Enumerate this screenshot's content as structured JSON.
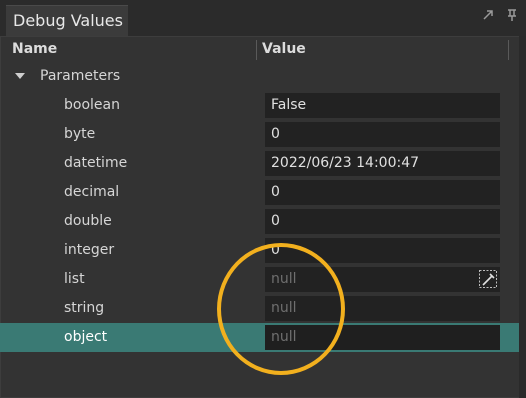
{
  "window": {
    "title": "Debug Values"
  },
  "columns": {
    "name": "Name",
    "value": "Value"
  },
  "group": {
    "label": "Parameters"
  },
  "rows": [
    {
      "name": "boolean",
      "value": "False",
      "is_null": false
    },
    {
      "name": "byte",
      "value": "0",
      "is_null": false
    },
    {
      "name": "datetime",
      "value": "2022/06/23 14:00:47",
      "is_null": false
    },
    {
      "name": "decimal",
      "value": "0",
      "is_null": false
    },
    {
      "name": "double",
      "value": "0",
      "is_null": false
    },
    {
      "name": "integer",
      "value": "0",
      "is_null": false
    },
    {
      "name": "list",
      "value": "null",
      "is_null": true,
      "has_edit_button": true
    },
    {
      "name": "string",
      "value": "null",
      "is_null": true
    },
    {
      "name": "object",
      "value": "null",
      "is_null": true,
      "selected": true
    }
  ],
  "icons": {
    "window": [
      "maximize-icon",
      "pin-icon"
    ],
    "group": "expand-triangle-icon",
    "list": "edit-icon"
  },
  "colors": {
    "selection": "#3a7a74",
    "highlight": "#f2b01e"
  }
}
